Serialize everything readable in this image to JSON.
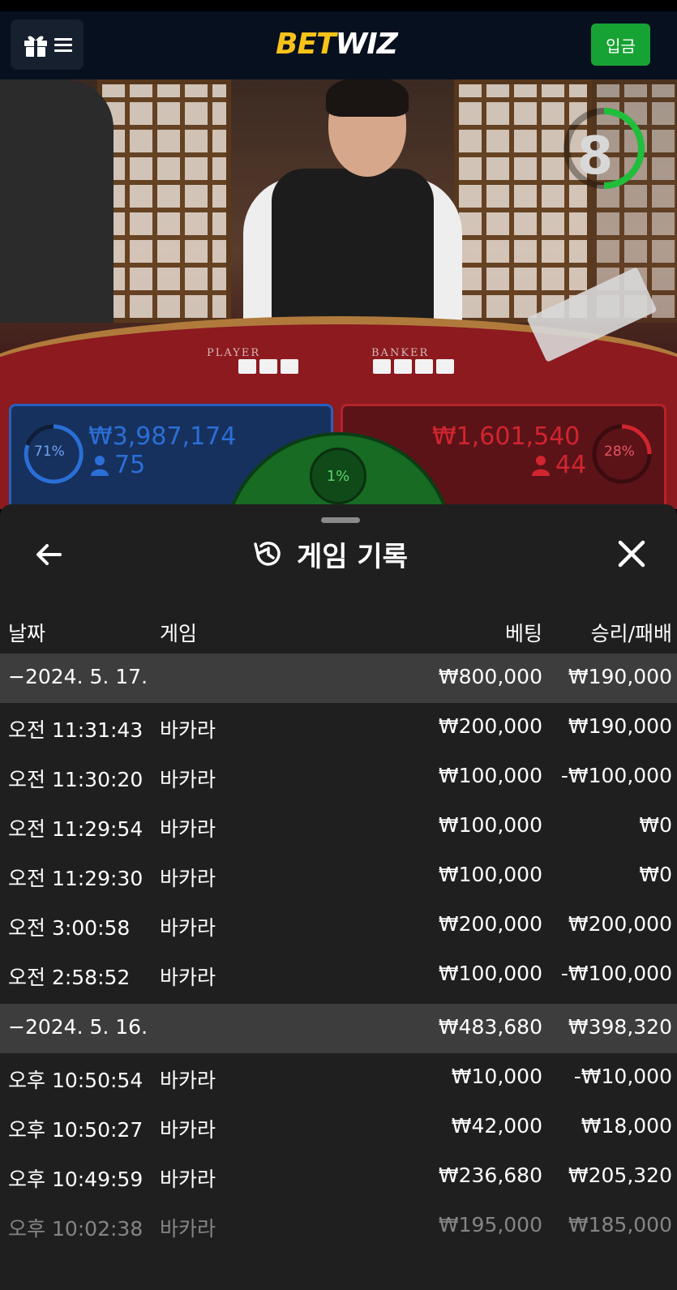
{
  "header": {
    "logo_bet": "BET",
    "logo_wiz": "WIZ",
    "deposit_label": "입금"
  },
  "video": {
    "countdown": "8",
    "player_label": "PLAYER",
    "banker_label": "BANKER"
  },
  "betting": {
    "player": {
      "percent": "71%",
      "amount": "₩3,987,174",
      "count": "75",
      "color": "#2a6fd6"
    },
    "banker": {
      "percent": "28%",
      "amount": "₩1,601,540",
      "count": "44",
      "color": "#d1252f"
    },
    "tie_percent": "1%"
  },
  "history": {
    "title": "게임 기록",
    "columns": {
      "date": "날짜",
      "game": "게임",
      "bet": "베팅",
      "result": "승리/패배"
    },
    "rows": [
      {
        "type": "date",
        "time": "−2024. 5. 17.",
        "game": "",
        "bet": "₩800,000",
        "result": "₩190,000"
      },
      {
        "type": "game",
        "time": "오전 11:31:43",
        "game": "바카라",
        "bet": "₩200,000",
        "result": "₩190,000"
      },
      {
        "type": "game",
        "time": "오전 11:30:20",
        "game": "바카라",
        "bet": "₩100,000",
        "result": "-₩100,000"
      },
      {
        "type": "game",
        "time": "오전 11:29:54",
        "game": "바카라",
        "bet": "₩100,000",
        "result": "₩0"
      },
      {
        "type": "game",
        "time": "오전 11:29:30",
        "game": "바카라",
        "bet": "₩100,000",
        "result": "₩0"
      },
      {
        "type": "game",
        "time": "오전 3:00:58",
        "game": "바카라",
        "bet": "₩200,000",
        "result": "₩200,000"
      },
      {
        "type": "game",
        "time": "오전 2:58:52",
        "game": "바카라",
        "bet": "₩100,000",
        "result": "-₩100,000"
      },
      {
        "type": "date",
        "time": "−2024. 5. 16.",
        "game": "",
        "bet": "₩483,680",
        "result": "₩398,320"
      },
      {
        "type": "game",
        "time": "오후 10:50:54",
        "game": "바카라",
        "bet": "₩10,000",
        "result": "-₩10,000"
      },
      {
        "type": "game",
        "time": "오후 10:50:27",
        "game": "바카라",
        "bet": "₩42,000",
        "result": "₩18,000"
      },
      {
        "type": "game",
        "time": "오후 10:49:59",
        "game": "바카라",
        "bet": "₩236,680",
        "result": "₩205,320"
      },
      {
        "type": "game",
        "time": "오후 10:02:38",
        "game": "바카라",
        "bet": "₩195,000",
        "result": "₩185,000"
      }
    ]
  }
}
